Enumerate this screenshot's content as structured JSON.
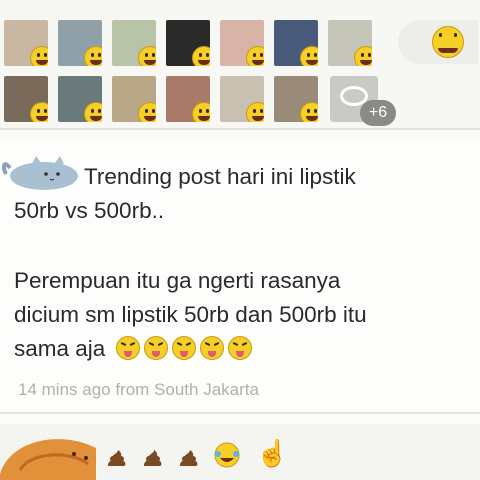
{
  "reactions": {
    "more_count": "+6",
    "thumbs": [
      {
        "name": "reaction-user-1",
        "color": "#c8b8a2"
      },
      {
        "name": "reaction-user-2",
        "color": "#8fa0a8"
      },
      {
        "name": "reaction-user-3",
        "color": "#b8c4a8"
      },
      {
        "name": "reaction-user-4",
        "color": "#2a2a2a"
      },
      {
        "name": "reaction-user-5",
        "color": "#d8b4a8"
      },
      {
        "name": "reaction-user-6",
        "color": "#4a5a7a"
      },
      {
        "name": "reaction-user-7",
        "color": "#c4c4b8"
      },
      {
        "name": "reaction-user-8",
        "color": "#7a6a5a"
      },
      {
        "name": "reaction-user-9",
        "color": "#6a7a7a"
      },
      {
        "name": "reaction-user-10",
        "color": "#b8a888"
      },
      {
        "name": "reaction-user-11",
        "color": "#a87a6a"
      },
      {
        "name": "reaction-user-12",
        "color": "#c8c0b0"
      },
      {
        "name": "reaction-user-13",
        "color": "#9a8a78"
      }
    ]
  },
  "post": {
    "line1": "Trending post hari ini lipstik",
    "line2": "50rb vs 500rb..",
    "para_line1": "Perempuan itu ga ngerti rasanya",
    "para_line2": "dicium sm lipstik 50rb dan 500rb itu",
    "para_line3": "sama aja",
    "emoji_count": 5,
    "meta": "14 mins ago from South Jakarta"
  },
  "colors": {
    "emoji_yellow": "#f5cf27",
    "meta_gray": "#b0b0ac",
    "text": "#2a2a2a"
  }
}
